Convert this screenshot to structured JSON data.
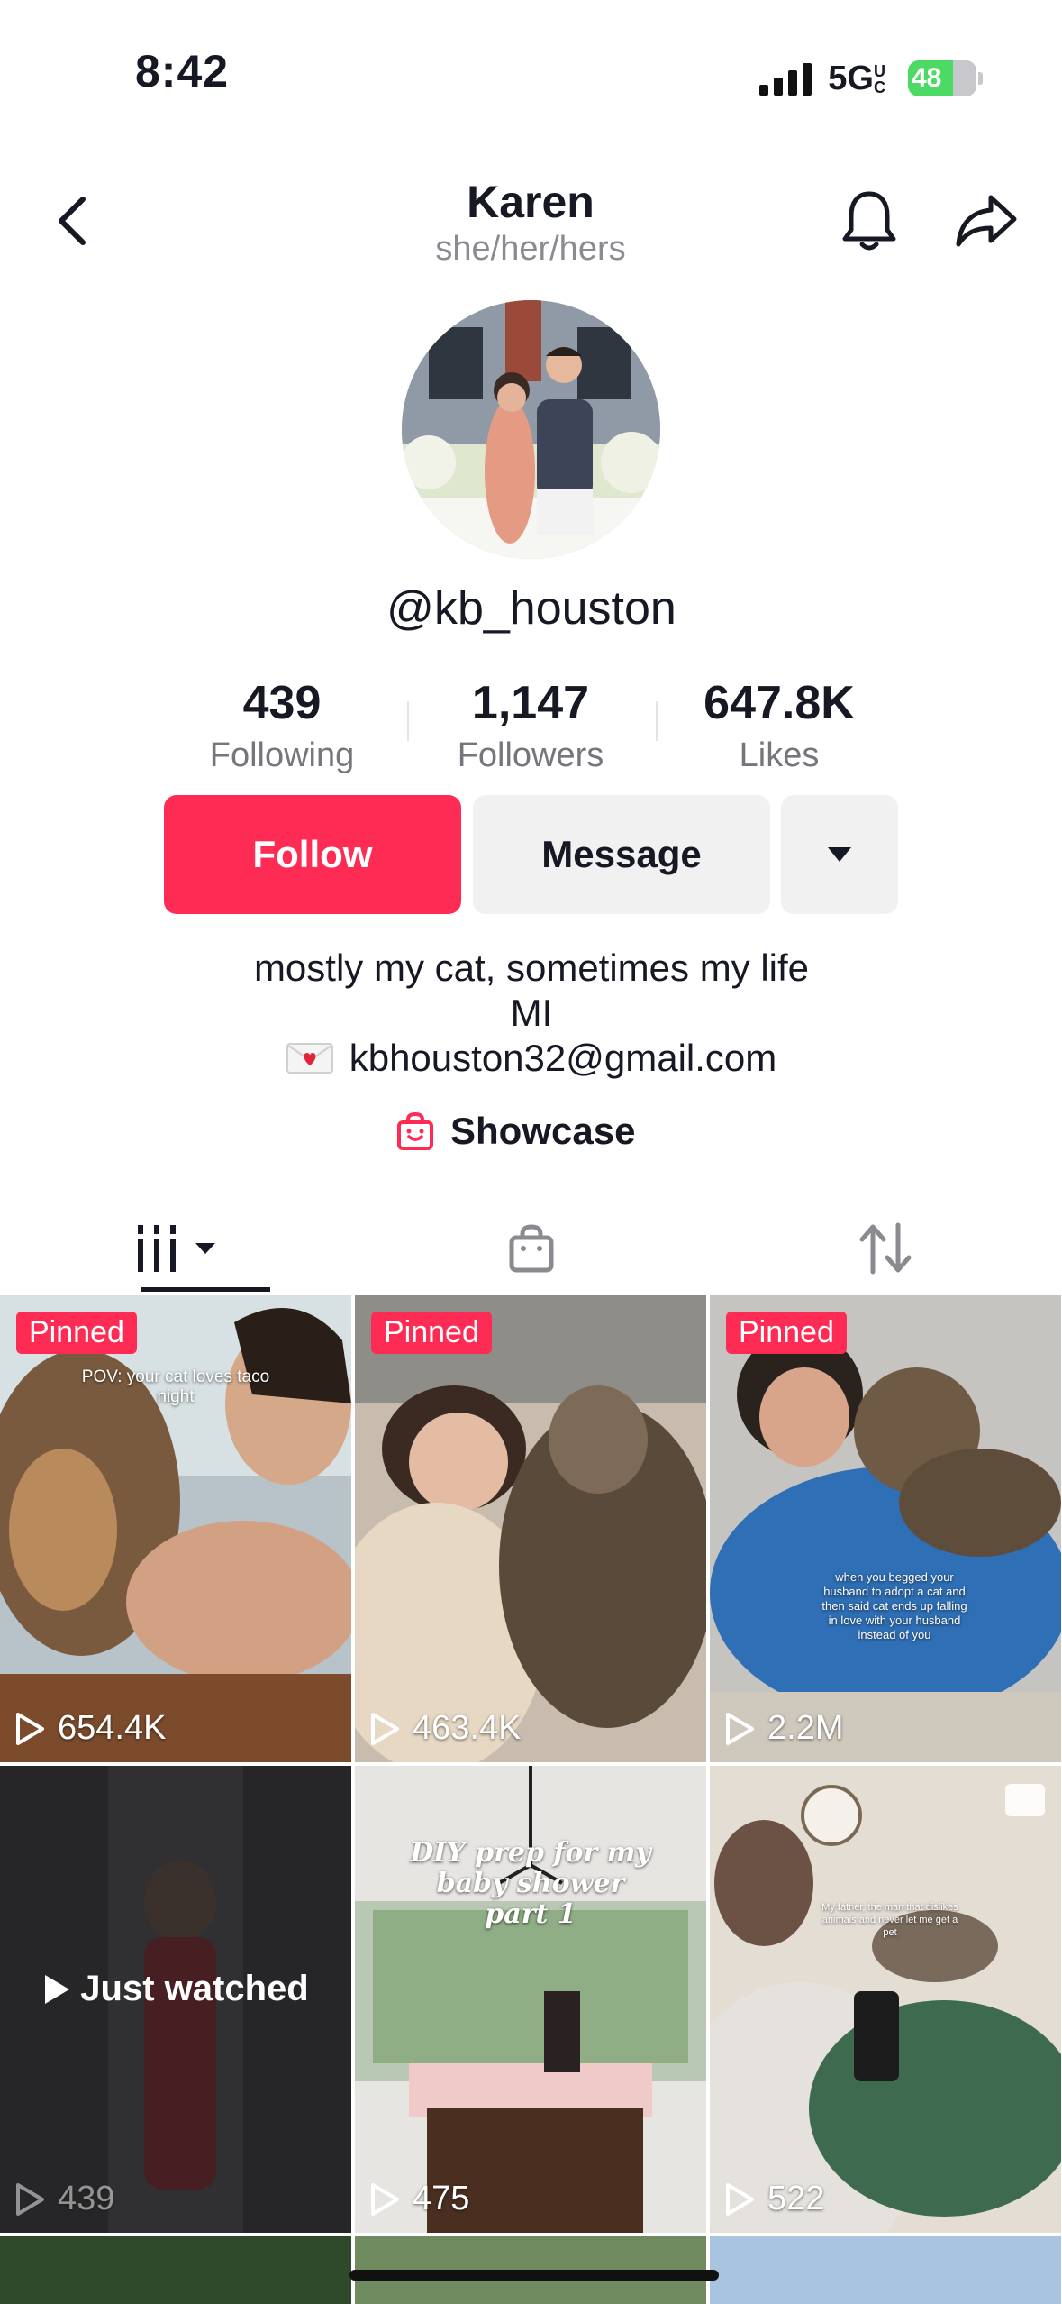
{
  "status_bar": {
    "time": "8:42",
    "network": "5G",
    "network_sub": "UC",
    "battery": "48"
  },
  "header": {
    "title": "Karen",
    "pronouns": "she/her/hers",
    "icons": [
      "back-arrow-icon",
      "bell-icon",
      "share-icon"
    ]
  },
  "profile": {
    "handle": "@kb_houston",
    "stats": [
      {
        "value": "439",
        "label": "Following"
      },
      {
        "value": "1,147",
        "label": "Followers"
      },
      {
        "value": "647.8K",
        "label": "Likes"
      }
    ],
    "follow_label": "Follow",
    "message_label": "Message",
    "bio_line1": "mostly my cat, sometimes my life",
    "bio_line2": "MI",
    "email": "kbhouston32@gmail.com",
    "showcase_label": "Showcase"
  },
  "tabs": [
    {
      "icon": "videos-grid-icon",
      "active": true
    },
    {
      "icon": "shopping-bag-icon",
      "active": false
    },
    {
      "icon": "repost-icon",
      "active": false
    }
  ],
  "videos": [
    {
      "pinned": "Pinned",
      "views": "654.4K",
      "caption": "POV: your cat loves taco night"
    },
    {
      "pinned": "Pinned",
      "views": "463.4K",
      "caption": ""
    },
    {
      "pinned": "Pinned",
      "views": "2.2M",
      "caption": "when you begged your husband to adopt a cat and then said cat ends up falling in love with your husband instead of you"
    },
    {
      "views": "439",
      "status": "Just watched"
    },
    {
      "views": "475",
      "caption": "DIY prep for my baby shower part 1"
    },
    {
      "views": "522",
      "caption": "My father, the man that dislikes animals and never let me get a pet"
    }
  ],
  "colors": {
    "accent": "#fe2c55",
    "secondary_button": "#f1f1f2",
    "muted_text": "#75767c"
  }
}
